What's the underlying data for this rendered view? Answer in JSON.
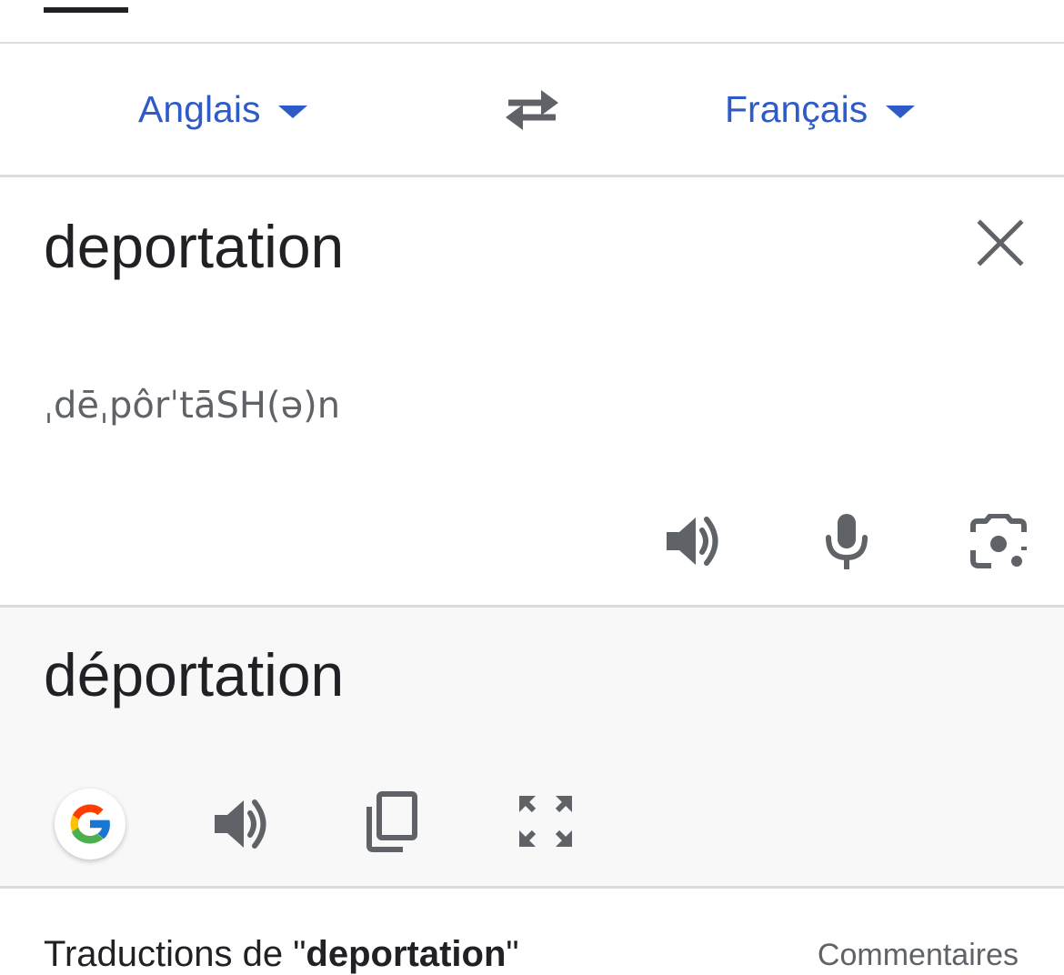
{
  "languages": {
    "source_label": "Anglais",
    "target_label": "Français"
  },
  "source": {
    "text": "deportation",
    "phonetic": "ˌdēˌpôrˈtāSH(ə)n"
  },
  "target": {
    "text": "déportation"
  },
  "translations_section": {
    "prefix": "Traductions de \"",
    "word": "deportation",
    "suffix": "\"",
    "feedback_label": "Commentaires"
  },
  "colors": {
    "link_blue": "#2f5bc8",
    "icon_gray": "#5f6368",
    "result_background": "#f8f8f8"
  },
  "icons": {
    "swap": "swap-languages-icon",
    "clear": "close-icon",
    "source_speaker": "speaker-icon",
    "microphone": "microphone-icon",
    "camera": "camera-icon",
    "google": "google-logo-icon",
    "target_speaker": "speaker-icon",
    "copy": "copy-icon",
    "fullscreen": "fullscreen-icon"
  }
}
